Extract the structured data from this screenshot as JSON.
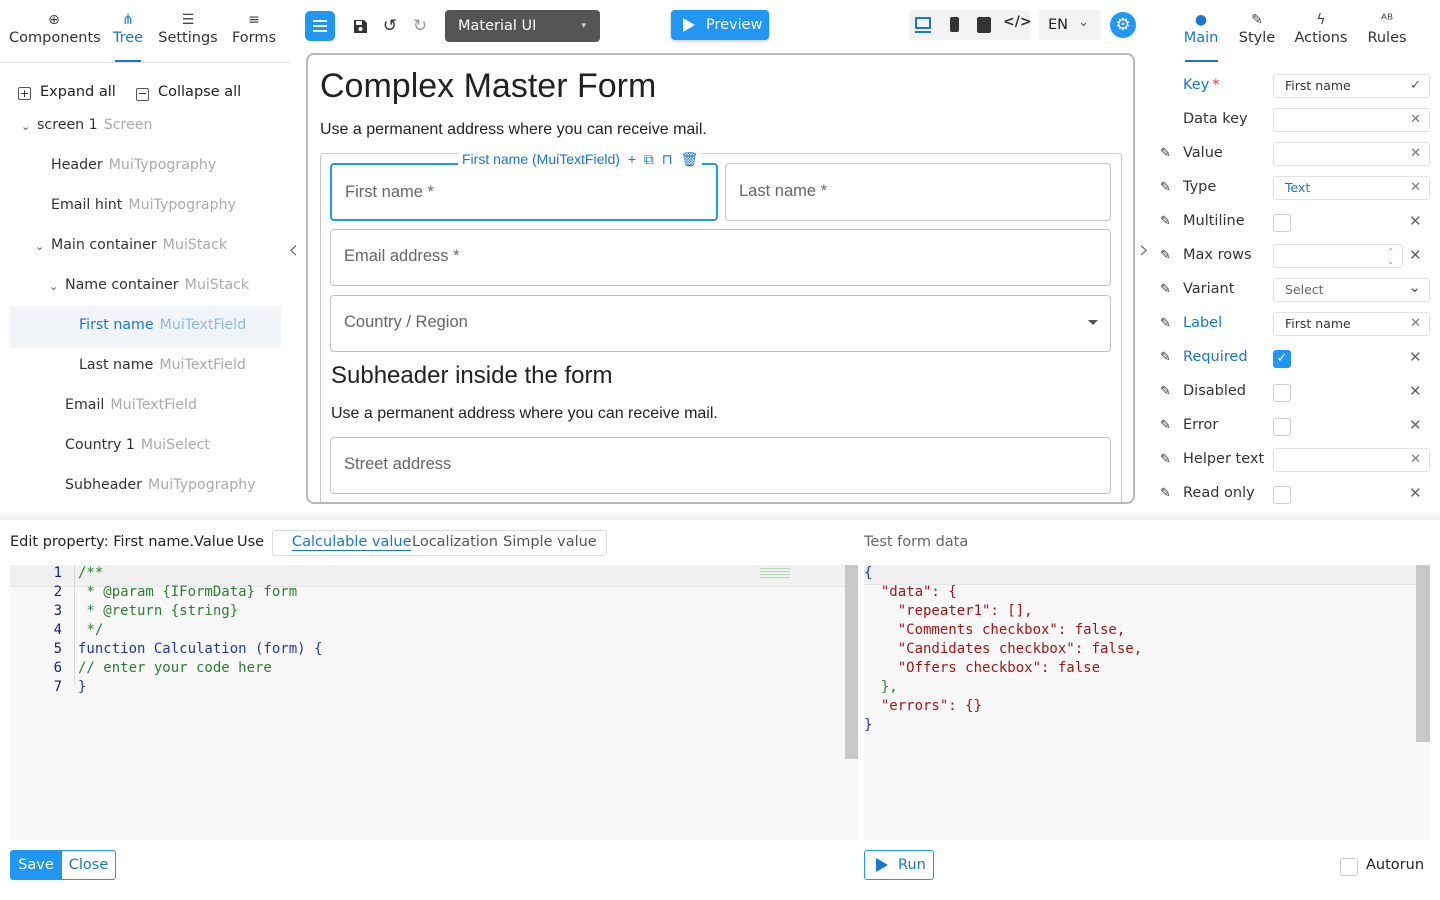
{
  "left_tabs": [
    {
      "label": "Components",
      "icon": "plus-circle-icon",
      "glyph": "⊕"
    },
    {
      "label": "Tree",
      "icon": "tree-icon",
      "glyph": "⋔"
    },
    {
      "label": "Settings",
      "icon": "sliders-icon",
      "glyph": "☰"
    },
    {
      "label": "Forms",
      "icon": "list-icon",
      "glyph": "≡"
    }
  ],
  "tree": {
    "expand_all": "Expand all",
    "collapse_all": "Collapse all",
    "items": [
      {
        "name": "screen 1",
        "type": "Screen"
      },
      {
        "name": "Header",
        "type": "MuiTypography"
      },
      {
        "name": "Email hint",
        "type": "MuiTypography"
      },
      {
        "name": "Main container",
        "type": "MuiStack"
      },
      {
        "name": "Name container",
        "type": "MuiStack"
      },
      {
        "name": "First name",
        "type": "MuiTextField"
      },
      {
        "name": "Last name",
        "type": "MuiTextField"
      },
      {
        "name": "Email",
        "type": "MuiTextField"
      },
      {
        "name": "Country 1",
        "type": "MuiSelect"
      },
      {
        "name": "Subheader",
        "type": "MuiTypography"
      }
    ]
  },
  "toolbar": {
    "theme": "Material UI",
    "preview": "Preview",
    "language": "EN"
  },
  "form": {
    "title": "Complex Master Form",
    "hint": "Use a permanent address where you can receive mail.",
    "selected_label": "First name (MuiTextField)",
    "first_name": "First name *",
    "last_name": "Last name *",
    "email": "Email address *",
    "country": "Country / Region",
    "subheader": "Subheader inside the form",
    "subhint": "Use a permanent address where you can receive mail.",
    "street": "Street address"
  },
  "right_tabs": [
    {
      "label": "Main",
      "icon": "circle-icon",
      "glyph": "●"
    },
    {
      "label": "Style",
      "icon": "brush-icon",
      "glyph": "✎"
    },
    {
      "label": "Actions",
      "icon": "lightning-icon",
      "glyph": "ϟ"
    },
    {
      "label": "Rules",
      "icon": "spellcheck-icon",
      "glyph": "ᴬᴮ"
    }
  ],
  "props": {
    "key": {
      "label": "Key",
      "value": "First name"
    },
    "data_key": {
      "label": "Data key",
      "value": ""
    },
    "value": {
      "label": "Value",
      "value": ""
    },
    "type": {
      "label": "Type",
      "value": "Text"
    },
    "multiline": {
      "label": "Multiline"
    },
    "max_rows": {
      "label": "Max rows",
      "value": ""
    },
    "variant": {
      "label": "Variant",
      "value": "Select"
    },
    "label": {
      "label": "Label",
      "value": "First name"
    },
    "required": {
      "label": "Required"
    },
    "disabled": {
      "label": "Disabled"
    },
    "error": {
      "label": "Error"
    },
    "helper_text": {
      "label": "Helper text",
      "value": ""
    },
    "read_only": {
      "label": "Read only"
    }
  },
  "bottom": {
    "edit_title": "Edit property: First name.Value",
    "use_label": "Use",
    "use_tabs": [
      "Calculable value",
      "Localization",
      "Simple value"
    ],
    "code_lines": [
      "/**",
      " * @param {IFormData} form",
      " * @return {string}",
      " */",
      "function Calculation (form) {",
      "// enter your code here",
      "}"
    ],
    "line_numbers": [
      "1",
      "2",
      "3",
      "4",
      "5",
      "6",
      "7"
    ],
    "test_data_title": "Test form data",
    "json_lines": [
      "{",
      "  \"data\": {",
      "    \"repeater1\": [],",
      "    \"Comments checkbox\": false,",
      "    \"Candidates checkbox\": false,",
      "    \"Offers checkbox\": false",
      "  },",
      "  \"errors\": {}",
      "}"
    ],
    "save": "Save",
    "close": "Close",
    "run": "Run",
    "autorun": "Autorun"
  },
  "colors": {
    "accent": "#2196f3",
    "accent_text": "#1976d2"
  }
}
